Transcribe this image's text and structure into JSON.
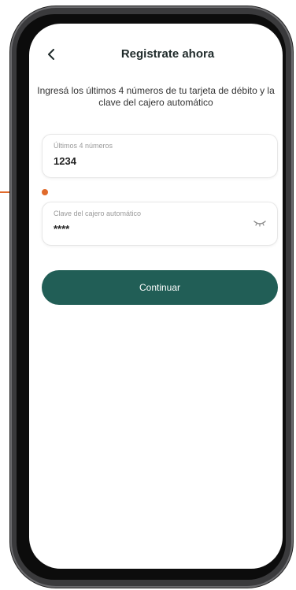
{
  "header": {
    "title": "Registrate ahora",
    "back_icon": "chevron-left-icon"
  },
  "instructions": "Ingresá los últimos 4 números de tu tarjeta de débito y la clave del cajero automático",
  "form": {
    "last_digits": {
      "label": "Últimos 4 números",
      "value": "1234"
    },
    "pin": {
      "label": "Clave del cajero automático",
      "value": "****",
      "toggle_icon": "eye-closed-icon"
    }
  },
  "continue_button": {
    "label": "Continuar"
  },
  "colors": {
    "primary": "#215e56",
    "callout": "#e06a2b",
    "title": "#1f2a2a"
  }
}
